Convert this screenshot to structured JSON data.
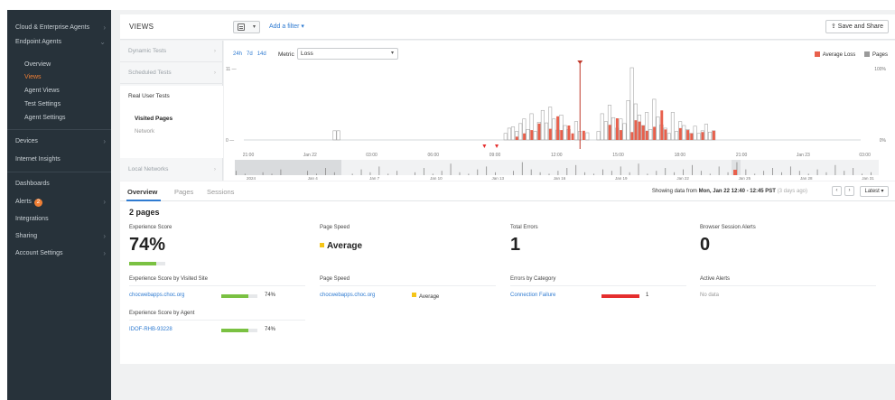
{
  "sidebar": {
    "items": [
      {
        "label": "Cloud & Enterprise Agents"
      },
      {
        "label": "Endpoint Agents"
      },
      {
        "label": "Overview"
      },
      {
        "label": "Views"
      },
      {
        "label": "Agent Views"
      },
      {
        "label": "Test Settings"
      },
      {
        "label": "Agent Settings"
      },
      {
        "label": "Devices"
      },
      {
        "label": "Internet Insights"
      },
      {
        "label": "Dashboards"
      },
      {
        "label": "Alerts",
        "badge": "2"
      },
      {
        "label": "Integrations"
      },
      {
        "label": "Sharing"
      },
      {
        "label": "Account Settings"
      }
    ]
  },
  "header": {
    "title": "VIEWS",
    "add_filter": "Add a filter ▾",
    "save_share": "Save and Share"
  },
  "leftnav": {
    "dynamic": "Dynamic Tests",
    "scheduled": "Scheduled Tests",
    "rut": "Real User Tests",
    "visited": "Visited Pages",
    "network": "Network",
    "local": "Local Networks"
  },
  "chart_controls": {
    "ranges": [
      "24h",
      "7d",
      "14d"
    ],
    "metric_label": "Metric",
    "metric_value": "Loss",
    "legend": [
      {
        "label": "Average Loss",
        "color": "#e8604c"
      },
      {
        "label": "Pages",
        "color": "#9a9a9a"
      }
    ]
  },
  "chart_data": {
    "type": "bar",
    "x_tick_labels": [
      "21:00",
      "Jan 22",
      "03:00",
      "06:00",
      "09:00",
      "12:00",
      "15:00",
      "18:00",
      "21:00",
      "Jan 23",
      "03:00"
    ],
    "y_left_ticks": [
      "11 —",
      "0 —"
    ],
    "y_right_ticks": [
      "100%",
      "0%"
    ],
    "timeline_labels": [
      "2024",
      "Jan 4",
      "Jan 7",
      "Jan 10",
      "Jan 13",
      "Jan 16",
      "Jan 19",
      "Jan 22",
      "Jan 25",
      "Jan 28",
      "Jan 31"
    ],
    "series": [
      {
        "name": "Pages",
        "color": "#9a9a9a",
        "values": [
          0,
          0,
          0,
          0,
          0,
          0,
          0,
          0,
          0,
          0,
          0,
          0,
          0,
          0,
          0,
          0,
          0,
          0,
          0,
          0,
          0,
          0,
          0,
          0,
          1.4,
          1.4,
          0,
          0,
          0,
          0,
          0,
          0,
          0,
          0,
          0,
          0,
          0,
          0,
          0,
          0,
          0,
          0,
          0,
          0,
          0,
          0,
          0,
          0,
          0,
          0,
          0,
          0,
          0,
          0,
          0,
          0,
          0,
          0,
          0,
          0,
          0,
          0,
          0,
          0,
          0,
          0,
          0,
          0,
          0,
          0,
          1,
          1.8,
          2,
          1.3,
          2.5,
          3.2,
          1.6,
          4,
          1.3,
          2.7,
          4.5,
          2.6,
          5,
          3.2,
          1.5,
          3.8,
          2.2,
          1.6,
          0,
          2.8,
          1.3,
          0,
          1.1,
          0,
          0,
          1.3,
          4,
          2.8,
          5.3,
          3.4,
          1.8,
          3.2,
          2.5,
          6,
          11,
          5.5,
          3.8,
          2.2,
          4.2,
          1.6,
          6.2,
          3.5,
          2.3,
          1.8,
          1,
          4.2,
          1.3,
          2.8,
          2.2,
          1.6,
          1,
          2.1,
          1,
          1.4,
          2.4,
          1.2,
          1.4,
          0,
          0,
          0,
          0,
          0,
          0,
          0,
          0,
          0,
          0,
          0,
          0,
          0,
          0,
          0,
          0,
          0,
          0,
          0,
          0,
          0,
          0,
          0,
          0,
          0,
          0,
          0,
          0,
          0,
          0,
          0,
          0,
          0,
          0,
          0,
          0,
          0,
          0,
          0
        ]
      },
      {
        "name": "Average Loss",
        "color": "#e8604c",
        "values": [
          0,
          0,
          0,
          0,
          0,
          0,
          0,
          0,
          0,
          0,
          0,
          0,
          0,
          0,
          0,
          0,
          0,
          0,
          0,
          0,
          0,
          0,
          0,
          0,
          0,
          0,
          0,
          0,
          0,
          0,
          0,
          0,
          0,
          0,
          0,
          0,
          0,
          0,
          0,
          0,
          0,
          0,
          0,
          0,
          0,
          0,
          0,
          0,
          0,
          0,
          0,
          0,
          0,
          0,
          0,
          0,
          0,
          0,
          0,
          0,
          0,
          0,
          0,
          0,
          0,
          0,
          0,
          0,
          0,
          0,
          0,
          0,
          0,
          0.5,
          0,
          1,
          0,
          1.5,
          0,
          2.5,
          0,
          0,
          1.7,
          0,
          3.6,
          1.5,
          0,
          2.2,
          1,
          0,
          0,
          1.4,
          0,
          0,
          0,
          0,
          0,
          0,
          2.3,
          0,
          3.3,
          1.5,
          0,
          0,
          1.2,
          3,
          2.8,
          2.2,
          1.4,
          0,
          2,
          0,
          4.5,
          1.6,
          0,
          0,
          0,
          1.8,
          0,
          1.5,
          1,
          0,
          0,
          1.2,
          0,
          0,
          1.4,
          0,
          0,
          0,
          0,
          0,
          0,
          0,
          0,
          0,
          0,
          0,
          0,
          0,
          0,
          0,
          0,
          0,
          0,
          0,
          0,
          0,
          0,
          0,
          0,
          0,
          0,
          0,
          0,
          0,
          0,
          0,
          0,
          0,
          0,
          0,
          0,
          0,
          0,
          0,
          0
        ]
      }
    ],
    "ylim": [
      0,
      11
    ]
  },
  "tabs": [
    "Overview",
    "Pages",
    "Sessions"
  ],
  "status": {
    "showing_prefix": "Showing data from ",
    "showing_range": "Mon, Jan 22 12:40 - 12:45 PST",
    "showing_ago": " (3 days ago)",
    "latest": "Latest ▾",
    "prev": "‹",
    "next": "›"
  },
  "overview": {
    "count_title": "2 pages",
    "experience_score_label": "Experience Score",
    "experience_score": "74%",
    "experience_score_fraction": 0.74,
    "page_speed_label": "Page Speed",
    "page_speed": "Average",
    "total_errors_label": "Total Errors",
    "total_errors": "1",
    "browser_alerts_label": "Browser Session Alerts",
    "browser_alerts": "0",
    "by_site_label": "Experience Score by Visited Site",
    "site_name": "chocweb​apps.choc.org",
    "site_score": "74%",
    "site_speed_label": "Page Speed",
    "site_speed_name": "chocweb​apps.choc.org",
    "site_speed_value": "Average",
    "errors_by_cat_label": "Errors by Category",
    "error_cat": "Connection Failure",
    "error_cat_count": "1",
    "active_alerts_label": "Active Alerts",
    "no_data": "No data",
    "by_agent_label": "Experience Score by Agent",
    "agent_name": "IDOF-RHB-93228",
    "agent_score": "74%"
  }
}
